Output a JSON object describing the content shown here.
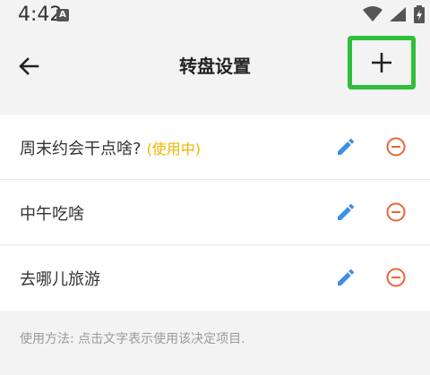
{
  "status": {
    "time": "4:42",
    "notification_letter": "A"
  },
  "app_bar": {
    "title": "转盘设置"
  },
  "items": [
    {
      "label": "周末约会干点啥?",
      "badge": "(使用中)"
    },
    {
      "label": "中午吃啥",
      "badge": ""
    },
    {
      "label": "去哪儿旅游",
      "badge": ""
    }
  ],
  "help_text": "使用方法: 点击文字表示使用该决定项目.",
  "colors": {
    "accent_badge": "#f0b400",
    "edit_icon": "#3f8ee8",
    "remove_icon": "#e8653a",
    "highlight_box": "#2fbf3a"
  },
  "icons": {
    "back": "arrow-back-icon",
    "add": "plus-icon",
    "edit": "pencil-icon",
    "remove": "minus-circle-icon"
  }
}
